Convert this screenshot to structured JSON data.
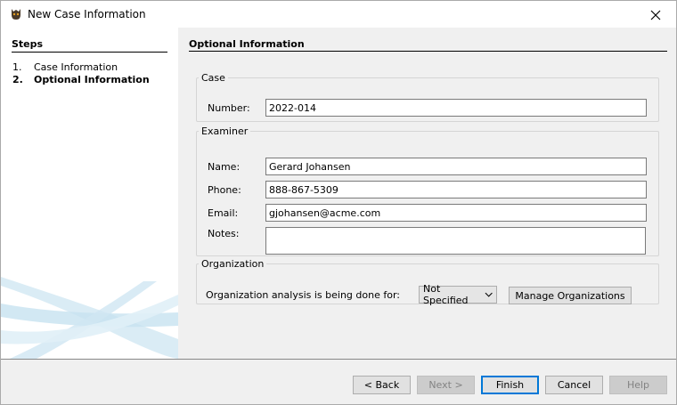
{
  "window": {
    "title": "New Case Information",
    "close_glyph": "✕"
  },
  "steps": {
    "header": "Steps",
    "items": [
      {
        "num": "1.",
        "label": "Case Information",
        "active": false
      },
      {
        "num": "2.",
        "label": "Optional Information",
        "active": true
      }
    ]
  },
  "content": {
    "title": "Optional Information",
    "case": {
      "legend": "Case",
      "number_label": "Number:",
      "number_value": "2022-014"
    },
    "examiner": {
      "legend": "Examiner",
      "name_label": "Name:",
      "name_value": "Gerard Johansen",
      "phone_label": "Phone:",
      "phone_value": "888-867-5309",
      "email_label": "Email:",
      "email_value": "gjohansen@acme.com",
      "notes_label": "Notes:",
      "notes_value": ""
    },
    "organization": {
      "legend": "Organization",
      "prompt": "Organization analysis is being done for:",
      "selected": "Not Specified",
      "manage_label": "Manage Organizations"
    }
  },
  "footer": {
    "back": "< Back",
    "next": "Next >",
    "finish": "Finish",
    "cancel": "Cancel",
    "help": "Help"
  },
  "colors": {
    "accent": "#0078d7",
    "swoosh": "#bcdcec"
  }
}
